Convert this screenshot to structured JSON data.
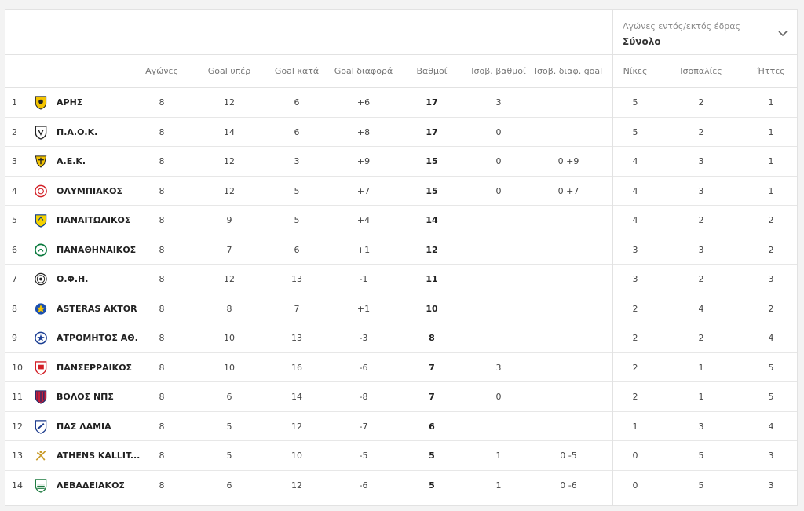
{
  "header": {
    "dropdown_label": "Αγώνες εντός/εκτός έδρας",
    "dropdown_value": "Σύνολο"
  },
  "columns": [
    "Αγώνες",
    "Goal υπέρ",
    "Goal κατά",
    "Goal διαφορά",
    "Βαθμοί",
    "Ισοβ. βαθμοί",
    "Ισοβ. διαφ. goal",
    "Νίκες",
    "Ισοπαλίες",
    "Ήττες"
  ],
  "colors": {
    "border": "#e2e2e2",
    "text": "#333333",
    "muted": "#777777"
  },
  "rows": [
    {
      "pos": "1",
      "team": "ΑΡΗΣ",
      "logo": "aris-logo-icon",
      "played": "8",
      "gf": "12",
      "ga": "6",
      "gd": "+6",
      "pts": "17",
      "tb_pts": "3",
      "tb_gd": "",
      "w": "5",
      "d": "2",
      "l": "1"
    },
    {
      "pos": "2",
      "team": "Π.Α.Ο.Κ.",
      "logo": "paok-logo-icon",
      "played": "8",
      "gf": "14",
      "ga": "6",
      "gd": "+8",
      "pts": "17",
      "tb_pts": "0",
      "tb_gd": "",
      "w": "5",
      "d": "2",
      "l": "1"
    },
    {
      "pos": "3",
      "team": "Α.Ε.Κ.",
      "logo": "aek-logo-icon",
      "played": "8",
      "gf": "12",
      "ga": "3",
      "gd": "+9",
      "pts": "15",
      "tb_pts": "0",
      "tb_gd": "0 +9",
      "w": "4",
      "d": "3",
      "l": "1"
    },
    {
      "pos": "4",
      "team": "ΟΛΥΜΠΙΑΚΟΣ",
      "logo": "olympiakos-logo-icon",
      "played": "8",
      "gf": "12",
      "ga": "5",
      "gd": "+7",
      "pts": "15",
      "tb_pts": "0",
      "tb_gd": "0 +7",
      "w": "4",
      "d": "3",
      "l": "1"
    },
    {
      "pos": "5",
      "team": "ΠΑΝΑΙΤΩΛΙΚΟΣ",
      "logo": "panaitolikos-logo-icon",
      "played": "8",
      "gf": "9",
      "ga": "5",
      "gd": "+4",
      "pts": "14",
      "tb_pts": "",
      "tb_gd": "",
      "w": "4",
      "d": "2",
      "l": "2"
    },
    {
      "pos": "6",
      "team": "ΠΑΝΑΘΗΝΑΙΚΟΣ",
      "logo": "panathinaikos-logo-icon",
      "played": "8",
      "gf": "7",
      "ga": "6",
      "gd": "+1",
      "pts": "12",
      "tb_pts": "",
      "tb_gd": "",
      "w": "3",
      "d": "3",
      "l": "2"
    },
    {
      "pos": "7",
      "team": "Ο.Φ.Η.",
      "logo": "ofi-logo-icon",
      "played": "8",
      "gf": "12",
      "ga": "13",
      "gd": "-1",
      "pts": "11",
      "tb_pts": "",
      "tb_gd": "",
      "w": "3",
      "d": "2",
      "l": "3"
    },
    {
      "pos": "8",
      "team": "ASTERAS AKTOR",
      "logo": "asteras-logo-icon",
      "played": "8",
      "gf": "8",
      "ga": "7",
      "gd": "+1",
      "pts": "10",
      "tb_pts": "",
      "tb_gd": "",
      "w": "2",
      "d": "4",
      "l": "2"
    },
    {
      "pos": "9",
      "team": "ΑΤΡΟΜΗΤΟΣ ΑΘ.",
      "logo": "atromitos-logo-icon",
      "played": "8",
      "gf": "10",
      "ga": "13",
      "gd": "-3",
      "pts": "8",
      "tb_pts": "",
      "tb_gd": "",
      "w": "2",
      "d": "2",
      "l": "4"
    },
    {
      "pos": "10",
      "team": "ΠΑΝΣΕΡΡΑΙΚΟΣ",
      "logo": "panserraikos-logo-icon",
      "played": "8",
      "gf": "10",
      "ga": "16",
      "gd": "-6",
      "pts": "7",
      "tb_pts": "3",
      "tb_gd": "",
      "w": "2",
      "d": "1",
      "l": "5"
    },
    {
      "pos": "11",
      "team": "ΒΟΛΟΣ ΝΠΣ",
      "logo": "volos-logo-icon",
      "played": "8",
      "gf": "6",
      "ga": "14",
      "gd": "-8",
      "pts": "7",
      "tb_pts": "0",
      "tb_gd": "",
      "w": "2",
      "d": "1",
      "l": "5"
    },
    {
      "pos": "12",
      "team": "ΠΑΣ ΛΑΜΙΑ",
      "logo": "lamia-logo-icon",
      "played": "8",
      "gf": "5",
      "ga": "12",
      "gd": "-7",
      "pts": "6",
      "tb_pts": "",
      "tb_gd": "",
      "w": "1",
      "d": "3",
      "l": "4"
    },
    {
      "pos": "13",
      "team": "ATHENS KALLIT...",
      "logo": "kallithea-logo-icon",
      "played": "8",
      "gf": "5",
      "ga": "10",
      "gd": "-5",
      "pts": "5",
      "tb_pts": "1",
      "tb_gd": "0 -5",
      "w": "0",
      "d": "5",
      "l": "3"
    },
    {
      "pos": "14",
      "team": "ΛΕΒΑΔΕΙΑΚΟΣ",
      "logo": "levadiakos-logo-icon",
      "played": "8",
      "gf": "6",
      "ga": "12",
      "gd": "-6",
      "pts": "5",
      "tb_pts": "1",
      "tb_gd": "0 -6",
      "w": "0",
      "d": "5",
      "l": "3"
    }
  ]
}
